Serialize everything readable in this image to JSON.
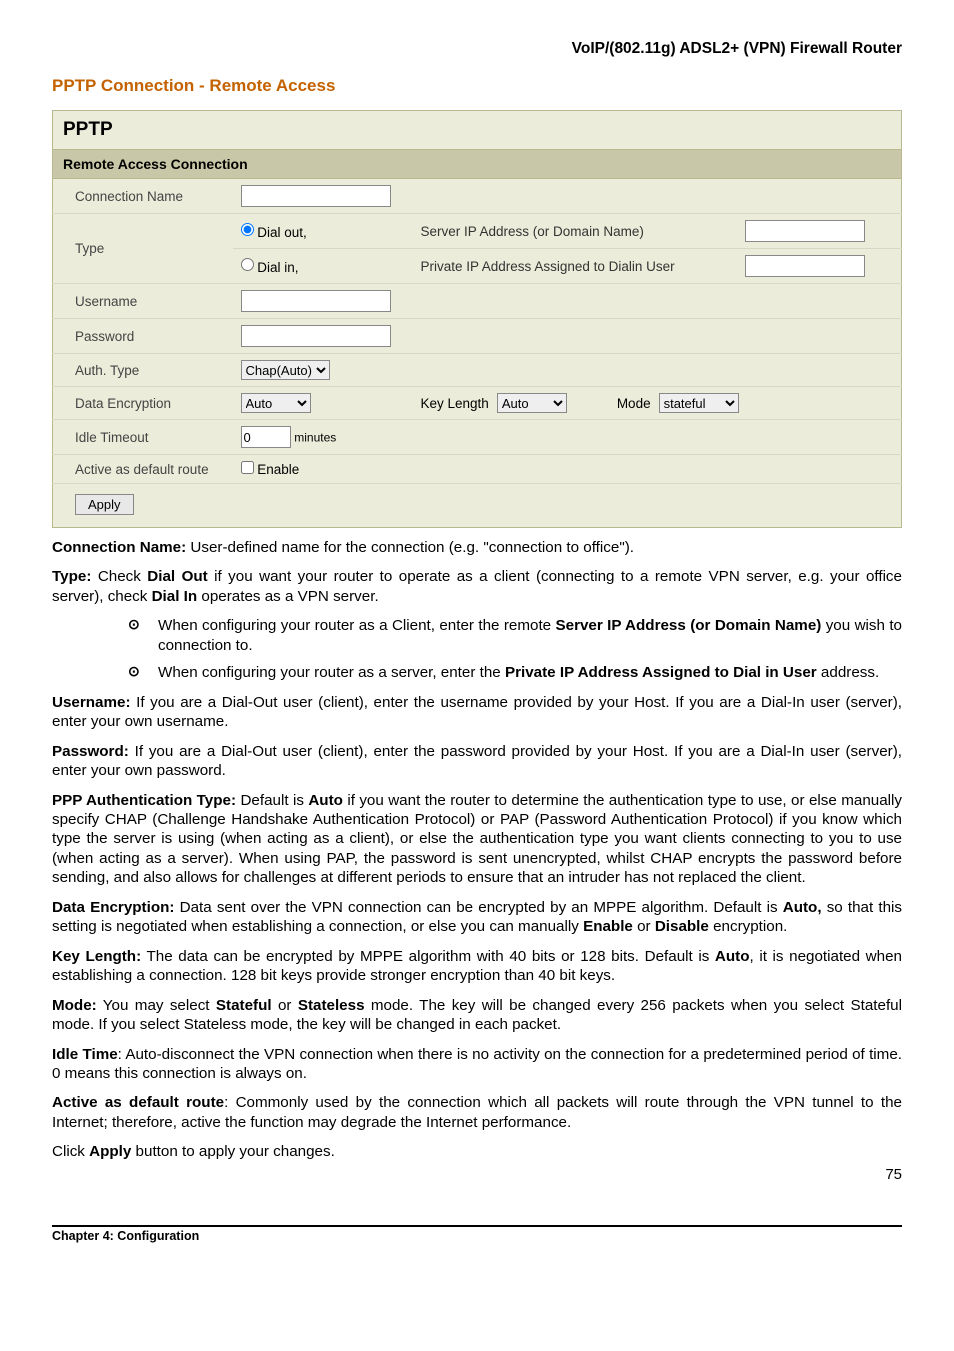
{
  "header": {
    "product": "VoIP/(802.11g) ADSL2+ (VPN) Firewall Router"
  },
  "section": {
    "title": "PPTP Connection - Remote Access"
  },
  "form": {
    "main_head": "PPTP",
    "sub_head": "Remote Access Connection",
    "rows": {
      "connection_name_label": "Connection Name",
      "connection_name_value": "",
      "type_label": "Type",
      "dial_out_label": "Dial out,",
      "dial_in_label": "Dial in,",
      "server_ip_label": "Server IP Address (or Domain Name)",
      "server_ip_value": "",
      "private_ip_label": "Private IP Address Assigned to Dialin User",
      "private_ip_value": "",
      "username_label": "Username",
      "username_value": "",
      "password_label": "Password",
      "password_value": "",
      "auth_type_label": "Auth. Type",
      "auth_type_value": "Chap(Auto)",
      "data_enc_label": "Data Encryption",
      "data_enc_value": "Auto",
      "key_length_label": "Key Length",
      "key_length_value": "Auto",
      "mode_label": "Mode",
      "mode_value": "stateful",
      "idle_timeout_label": "Idle Timeout",
      "idle_timeout_value": "0",
      "idle_timeout_unit": "minutes",
      "default_route_label": "Active as default route",
      "enable_label": "Enable",
      "apply_label": "Apply"
    }
  },
  "descriptions": {
    "conn_name": {
      "bold": "Connection Name:",
      "text": " User-defined name for the connection (e.g. \"connection to office\")."
    },
    "type": {
      "bold1": "Type:",
      "text1": " Check ",
      "bold2": "Dial Out",
      "text2": " if you want your router to operate as a client (connecting to a remote VPN server, e.g. your office server), check ",
      "bold3": "Dial In",
      "text3": " operates as a VPN server."
    },
    "bullet1": {
      "text1": "When configuring your router as a Client, enter the remote ",
      "bold": "Server IP Address (or Domain Name)",
      "text2": " you wish to connection to."
    },
    "bullet2": {
      "text1": "When configuring your router as a server, enter the ",
      "bold": "Private IP Address Assigned to Dial in User",
      "text2": " address."
    },
    "username": {
      "bold": "Username:",
      "text": " If you are a Dial-Out user (client), enter the username provided by your Host.   If you are a Dial-In user (server), enter your own username."
    },
    "password": {
      "bold": "Password:",
      "text": " If you are a Dial-Out user (client), enter the password provided by your Host.   If you are a Dial-In user (server), enter your own password."
    },
    "ppp_auth": {
      "bold1": "PPP Authentication Type:",
      "text1": " Default is ",
      "bold2": "Auto",
      "text2": " if you want the router to determine the authentication type to use, or else manually specify CHAP (Challenge Handshake Authentication Protocol) or PAP (Password Authentication Protocol) if you know which type the server is using (when acting as a client), or else the authentication type you want clients connecting to you to use (when acting as a server). When using PAP, the password is sent unencrypted, whilst CHAP encrypts the password before sending, and also allows for challenges at different periods to ensure that an intruder has not replaced the client."
    },
    "data_enc": {
      "bold1": "Data Encryption:",
      "text1": " Data sent over the VPN connection can be encrypted by an MPPE algorithm. Default is ",
      "bold2": "Auto,",
      "text2": " so that this setting is negotiated when establishing a connection, or else you can manually ",
      "bold3": "Enable",
      "text3": " or ",
      "bold4": "Disable",
      "text4": " encryption."
    },
    "key_length": {
      "bold1": "Key Length:",
      "text1": " The data can be encrypted by MPPE algorithm with 40 bits or 128 bits. Default is ",
      "bold2": "Auto",
      "text2": ", it is negotiated when establishing a connection. 128 bit keys provide stronger encryption than 40 bit keys."
    },
    "mode": {
      "bold1": "Mode:",
      "text1": " You may select ",
      "bold2": "Stateful",
      "text2": " or ",
      "bold3": "Stateless",
      "text3": " mode. The key will be changed every 256 packets when you select Stateful mode. If you select Stateless mode, the key will be changed in each packet."
    },
    "idle_time": {
      "bold": "Idle Time",
      "text": ": Auto-disconnect the VPN connection when there is no activity on the connection for a predetermined period of time. 0 means this connection is always on."
    },
    "active_route": {
      "bold": "Active as default route",
      "text": ": Commonly used by the             connection which all packets will route through the VPN tunnel to the Internet; therefore, active the function may degrade the Internet performance."
    },
    "click_apply": {
      "text1": "Click ",
      "bold": "Apply",
      "text2": " button to apply your changes."
    }
  },
  "footer": {
    "chapter": "Chapter 4: Configuration",
    "page": "75"
  }
}
